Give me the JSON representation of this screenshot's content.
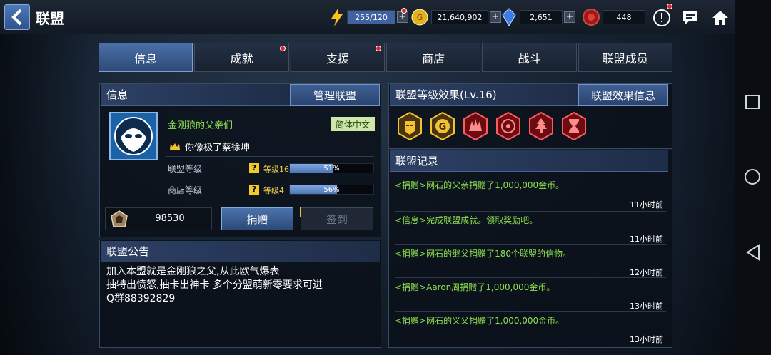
{
  "header": {
    "title": "联盟",
    "energy": "255/120",
    "gold": "21,640,902",
    "crystal": "2,651",
    "gem": "448"
  },
  "tabs": [
    {
      "label": "信息",
      "active": true,
      "badge": false
    },
    {
      "label": "成就",
      "active": false,
      "badge": true
    },
    {
      "label": "支援",
      "active": false,
      "badge": true
    },
    {
      "label": "商店",
      "active": false,
      "badge": false
    },
    {
      "label": "战斗",
      "active": false,
      "badge": false
    },
    {
      "label": "联盟成员",
      "active": false,
      "badge": false
    }
  ],
  "info": {
    "header": "信息",
    "manage_label": "管理联盟",
    "alliance_name": "金刚狼的父亲们",
    "language": "简体中文",
    "leader": "你像极了蔡徐坤",
    "alliance_level_label": "联盟等级",
    "alliance_level": "等级16",
    "alliance_level_pct": "51%",
    "alliance_level_fraction": 0.51,
    "shop_level_label": "商店等级",
    "shop_level": "等级4",
    "shop_level_pct": "56%",
    "shop_level_fraction": 0.56,
    "coins": "98530",
    "donate_label": "捐赠",
    "signin_label": "签到"
  },
  "notice": {
    "header": "联盟公告",
    "lines": [
      "加入本盟就是金刚狼之父,从此欧气爆表",
      "抽特出愤怒,抽卡出神卡 多个分盟萌新零要求可进",
      "Q群88392829"
    ]
  },
  "effects": {
    "header": "联盟等级效果(Lv.16)",
    "info_label": "联盟效果信息",
    "icons": [
      "iron-man-helmet-icon",
      "gold-g-icon",
      "rage-burst-icon",
      "target-icon",
      "tree-icon",
      "hourglass-icon"
    ]
  },
  "log": {
    "header": "联盟记录",
    "items": [
      {
        "text": "<捐赠>网石的父亲捐赠了1,000,000金币。",
        "time": "11小时前"
      },
      {
        "text": "<信息>完成联盟成就。领取奖励吧。",
        "time": "11小时前"
      },
      {
        "text": "<捐赠>网石的继父捐赠了180个联盟的信物。",
        "time": "12小时前"
      },
      {
        "text": "<捐赠>Aaron周捐赠了1,000,000金币。",
        "time": "13小时前"
      },
      {
        "text": "<捐赠>网石的义父捐赠了1,000,000金币。",
        "time": "13小时前"
      }
    ]
  }
}
